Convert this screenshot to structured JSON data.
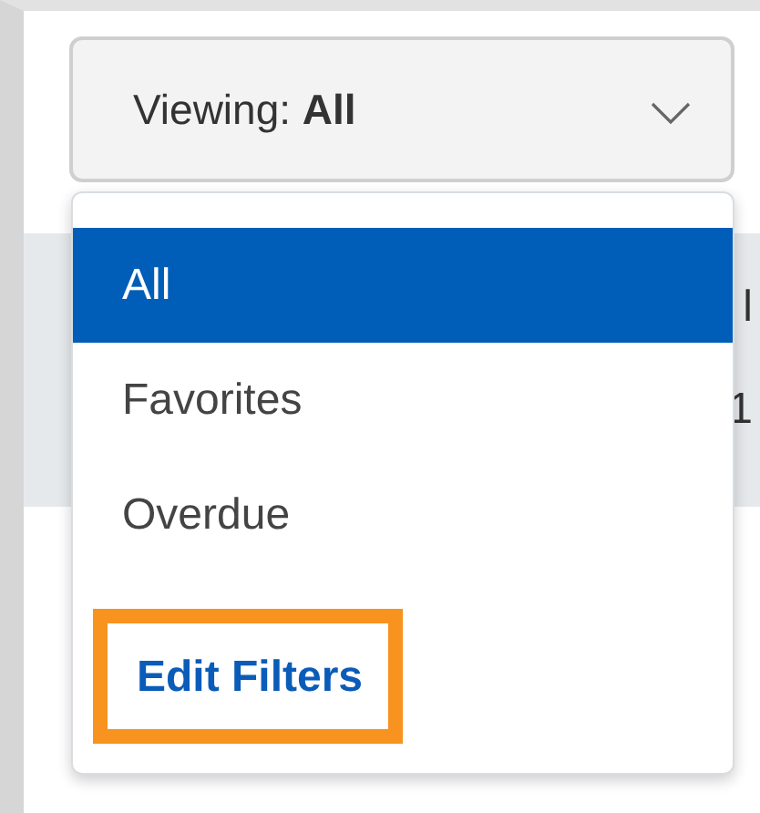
{
  "dropdown": {
    "label": "Viewing: **All**",
    "expanded": true
  },
  "menu": {
    "items": [
      {
        "label": "All",
        "selected": true,
        "kind": "option"
      },
      {
        "label": "Favorites",
        "selected": false,
        "kind": "option"
      },
      {
        "label": "Overdue",
        "selected": false,
        "kind": "option"
      },
      {
        "label": "Edit Filters",
        "selected": false,
        "kind": "link",
        "highlighted": true
      }
    ]
  },
  "background_rows": [
    {
      "column_2": "l"
    },
    {
      "column_2": "1"
    }
  ]
}
